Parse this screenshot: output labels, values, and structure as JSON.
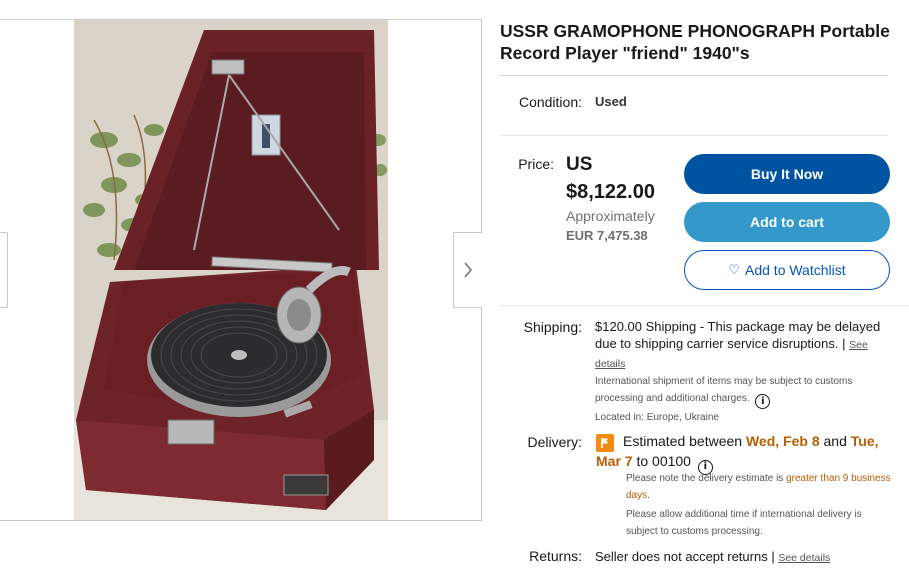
{
  "item": {
    "title": "USSR GRAMOPHONE PHONOGRAPH Portable Record Player \"friend\" 1940\"s",
    "image_alt": "Red portable gramophone with open lid and black turntable"
  },
  "gallery": {
    "prev_icon": "chevron-left-icon",
    "next_icon": "chevron-right-icon"
  },
  "condition": {
    "label": "Condition:",
    "value": "Used"
  },
  "price": {
    "label": "Price:",
    "currency": "US",
    "amount": "$8,122.00",
    "approx_label": "Approximately",
    "converted": "EUR 7,475.38"
  },
  "buttons": {
    "buy_now": "Buy It Now",
    "add_to_cart": "Add to cart",
    "watchlist": "Add to Watchlist"
  },
  "shipping": {
    "label": "Shipping:",
    "text": "$120.00 Shipping - This package may be delayed due to shipping carrier service disruptions. |",
    "see_details": "See details",
    "intl_note": "International shipment of items may be subject to customs processing and additional charges.",
    "location": "Located in: Europe, Ukraine"
  },
  "delivery": {
    "label": "Delivery:",
    "prefix": "Estimated between ",
    "start": "Wed, Feb 8",
    "and": " and ",
    "end": "Tue, Mar 7",
    "to": " to 00100",
    "note1_prefix": "Please note the delivery estimate is ",
    "note1_highlight": "greater than 9 business days",
    "note1_suffix": ".",
    "note2": "Please allow additional time if international delivery is subject to customs processing."
  },
  "returns": {
    "label": "Returns:",
    "text": "Seller does not accept returns |",
    "see_details": "See details"
  },
  "colors": {
    "buy_now_bg": "#0053a0",
    "add_to_cart_bg": "#3498ca",
    "watchlist_border": "#0654ba",
    "delivery_highlight": "#b45f06",
    "flag": "#f18c11"
  }
}
